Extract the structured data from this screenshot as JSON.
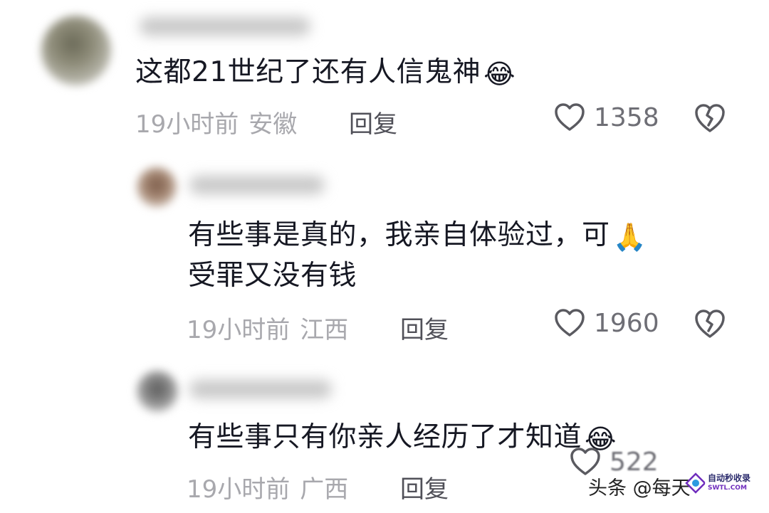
{
  "comments": [
    {
      "text": "这都21世纪了还有人信鬼神",
      "emoji": "😂",
      "time": "19小时前",
      "location": "安徽",
      "reply_label": "回复",
      "likes": "1358"
    },
    {
      "text_line1": "有些事是真的，我亲自体验过，可",
      "emoji": "🙏",
      "text_line2": "受罪又没有钱",
      "time": "19小时前",
      "location": "江西",
      "reply_label": "回复",
      "likes": "1960"
    },
    {
      "text": "有些事只有你亲人经历了才知道",
      "emoji": "😂",
      "time": "19小时前",
      "location": "广西",
      "reply_label": "回复",
      "likes": "522"
    }
  ],
  "watermark": {
    "text": "头条 @每天",
    "badge_line1": "自动秒收录",
    "badge_line2": "SWTL.COM"
  },
  "colors": {
    "text": "#161823",
    "meta": "#a8a8ad",
    "reply": "#505058",
    "icon": "#5a5a60"
  }
}
